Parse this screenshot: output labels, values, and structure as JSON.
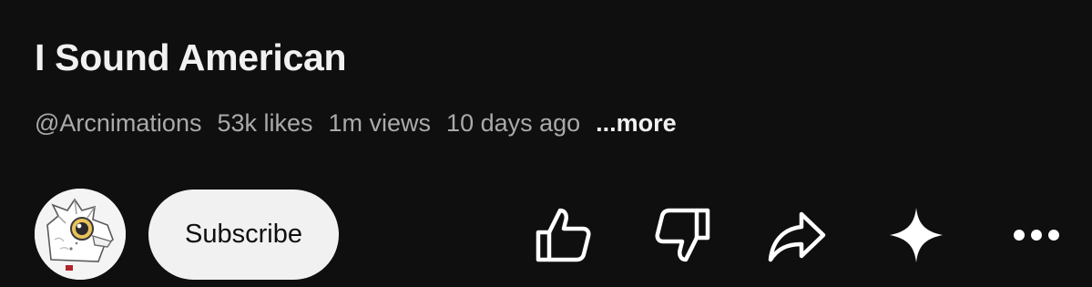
{
  "video": {
    "title": "I Sound American",
    "channel_handle": "@Arcnimations",
    "likes": "53k likes",
    "views": "1m views",
    "age": "10 days ago",
    "more_label": "...more"
  },
  "actions": {
    "subscribe_label": "Subscribe",
    "icons": [
      "like-icon",
      "dislike-icon",
      "share-icon",
      "sparkle-icon",
      "more-options-icon"
    ]
  },
  "colors": {
    "background": "#0f0f0f",
    "primary_text": "#f1f1f1",
    "secondary_text": "#aaaaaa",
    "subscribe_bg": "#f1f1f1"
  }
}
